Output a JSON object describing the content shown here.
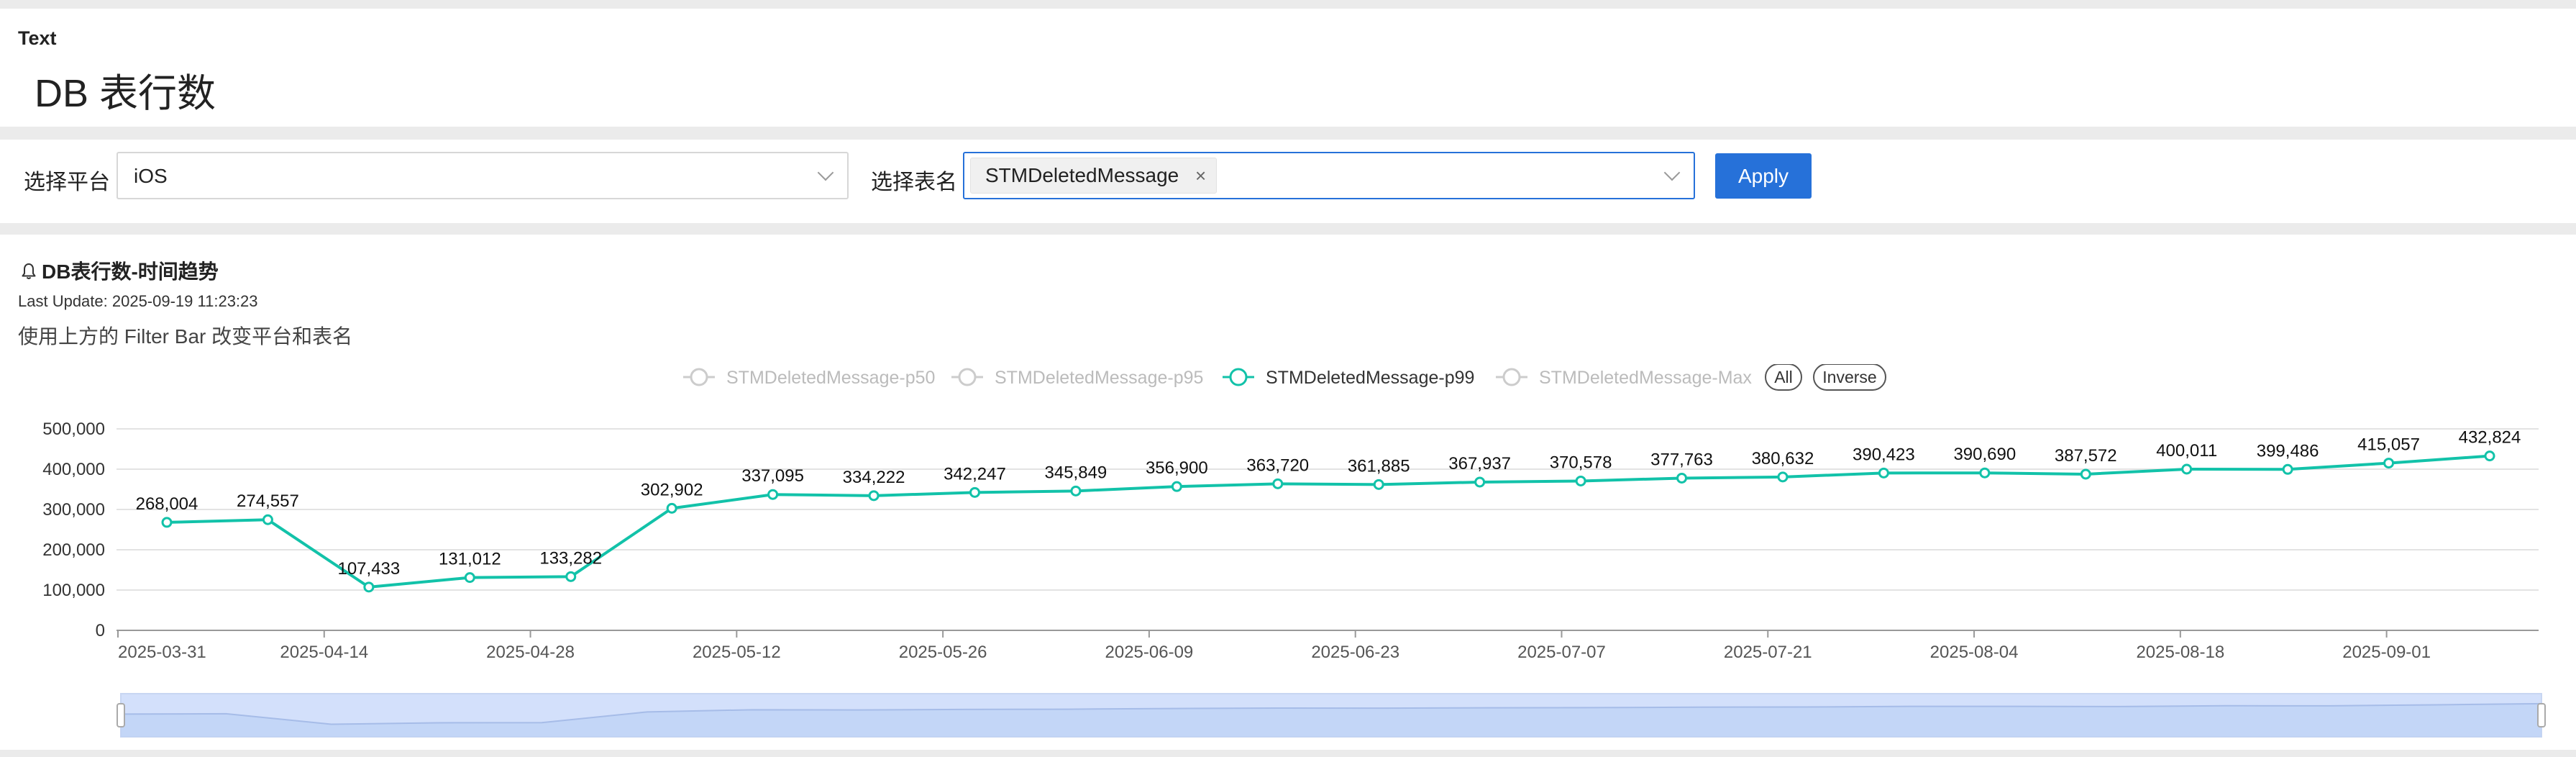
{
  "text_panel": {
    "label": "Text",
    "title": "DB 表行数"
  },
  "filter_bar": {
    "platform_label": "选择平台",
    "platform_value": "iOS",
    "table_label": "选择表名",
    "table_value": "STMDeletedMessage",
    "tag_remove": "×",
    "apply_label": "Apply"
  },
  "chart_panel": {
    "title": "DB表行数-时间趋势",
    "bell_icon": "bell-icon",
    "last_update": "Last Update: 2025-09-19 11:23:23",
    "description": "使用上方的 Filter Bar 改变平台和表名"
  },
  "legend": {
    "items": [
      {
        "label": "STMDeletedMessage-p50",
        "active": false
      },
      {
        "label": "STMDeletedMessage-p95",
        "active": false
      },
      {
        "label": "STMDeletedMessage-p99",
        "active": true
      },
      {
        "label": "STMDeletedMessage-Max",
        "active": false
      }
    ],
    "all_label": "All",
    "inverse_label": "Inverse"
  },
  "colors": {
    "series": "#12c2a9",
    "accent": "#2671d9",
    "inactive": "#cccccc",
    "zoom_fill": "#d3e0fb"
  },
  "chart_data": {
    "type": "line",
    "ylim": [
      0,
      500000
    ],
    "y_ticks": [
      "0",
      "100,000",
      "200,000",
      "300,000",
      "400,000",
      "500,000"
    ],
    "y_tick_values": [
      0,
      100000,
      200000,
      300000,
      400000,
      500000
    ],
    "x_ticks": [
      "2025-03-31",
      "2025-04-14",
      "2025-04-28",
      "2025-05-12",
      "2025-05-26",
      "2025-06-09",
      "2025-06-23",
      "2025-07-07",
      "2025-07-21",
      "2025-08-04",
      "2025-08-18",
      "2025-09-01"
    ],
    "x_tick_positions": [
      0,
      2,
      4,
      6,
      8,
      10,
      12,
      14,
      16,
      18,
      20,
      22
    ],
    "series": [
      {
        "name": "STMDeletedMessage-p99",
        "values": [
          268004,
          274557,
          107433,
          131012,
          133282,
          302902,
          337095,
          334222,
          342247,
          345849,
          356900,
          363720,
          361885,
          367937,
          370578,
          377763,
          380632,
          390423,
          390690,
          387572,
          400011,
          399486,
          415057,
          432824
        ],
        "labels": [
          "268,004",
          "274,557",
          "107,433",
          "131,012",
          "133,282",
          "302,902",
          "337,095",
          "334,222",
          "342,247",
          "345,849",
          "356,900",
          "363,720",
          "361,885",
          "367,937",
          "370,578",
          "377,763",
          "380,632",
          "390,423",
          "390,690",
          "387,572",
          "400,011",
          "399,486",
          "415,057",
          "432,824"
        ]
      }
    ],
    "grid": true,
    "legend_position": "top-center",
    "data_zoom": true
  }
}
